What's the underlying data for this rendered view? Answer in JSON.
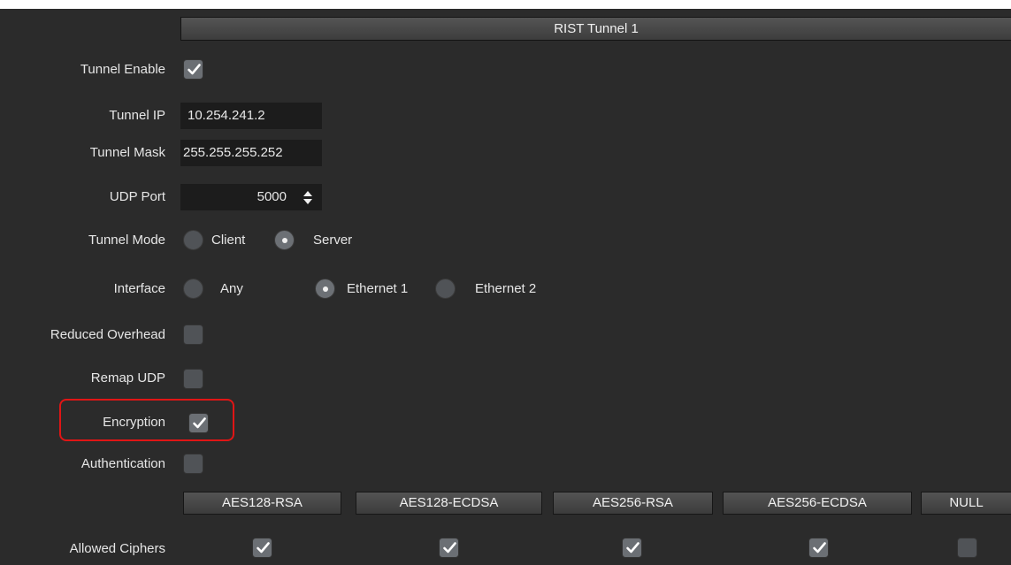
{
  "tunnel": {
    "title": "RIST Tunnel 1",
    "tunnel_enable": {
      "label": "Tunnel Enable",
      "checked": true
    },
    "tunnel_ip": {
      "label": "Tunnel IP",
      "value": "10.254.241.2"
    },
    "tunnel_mask": {
      "label": "Tunnel Mask",
      "value": "255.255.255.252"
    },
    "udp_port": {
      "label": "UDP Port",
      "value": "5000"
    },
    "tunnel_mode": {
      "label": "Tunnel Mode",
      "options": [
        "Client",
        "Server"
      ],
      "selected": "Server"
    },
    "interface": {
      "label": "Interface",
      "options": [
        "Any",
        "Ethernet 1",
        "Ethernet 2"
      ],
      "selected": "Ethernet 1"
    },
    "reduced_overhead": {
      "label": "Reduced Overhead",
      "checked": false
    },
    "remap_udp": {
      "label": "Remap UDP",
      "checked": false
    },
    "encryption": {
      "label": "Encryption",
      "checked": true
    },
    "authentication": {
      "label": "Authentication",
      "checked": false
    },
    "allowed_ciphers": {
      "label": "Allowed Ciphers",
      "ciphers": [
        {
          "name": "AES128-RSA",
          "checked": true
        },
        {
          "name": "AES128-ECDSA",
          "checked": true
        },
        {
          "name": "AES256-RSA",
          "checked": true
        },
        {
          "name": "AES256-ECDSA",
          "checked": true
        },
        {
          "name": "NULL",
          "checked": false
        }
      ]
    }
  },
  "colors": {
    "panel_bg": "#2b2b2b",
    "highlight": "#e01515"
  }
}
